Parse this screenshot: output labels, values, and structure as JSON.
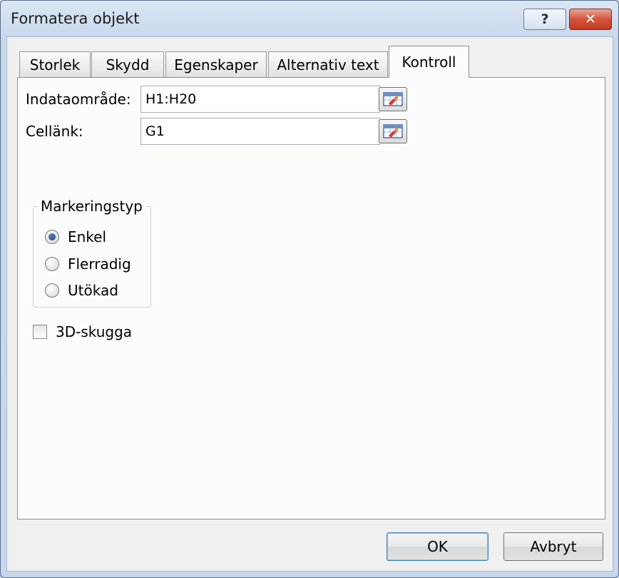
{
  "window": {
    "title": "Formatera objekt",
    "help_label": "?",
    "close_label": "✕"
  },
  "tabs": [
    {
      "label": "Storlek"
    },
    {
      "label": "Skydd"
    },
    {
      "label": "Egenskaper"
    },
    {
      "label": "Alternativ text"
    },
    {
      "label": "Kontroll",
      "active": true
    }
  ],
  "control": {
    "input_range_label": "Indataområde:",
    "input_range_value": "H1:H20",
    "cell_link_label": "Cellänk:",
    "cell_link_value": "G1",
    "ref_button_icon": "range-select-icon"
  },
  "selection_type": {
    "legend": "Markeringstyp",
    "options": [
      {
        "label": "Enkel",
        "selected": true
      },
      {
        "label": "Flerradig",
        "selected": false
      },
      {
        "label": "Utökad",
        "selected": false
      }
    ]
  },
  "shadow_checkbox": {
    "label": "3D-skugga",
    "checked": false
  },
  "buttons": {
    "ok_label": "OK",
    "cancel_label": "Avbryt"
  },
  "colors": {
    "close_button": "#c33c24",
    "selected_radio": "#1c3f7a",
    "default_button_border": "#3c7fb1"
  }
}
